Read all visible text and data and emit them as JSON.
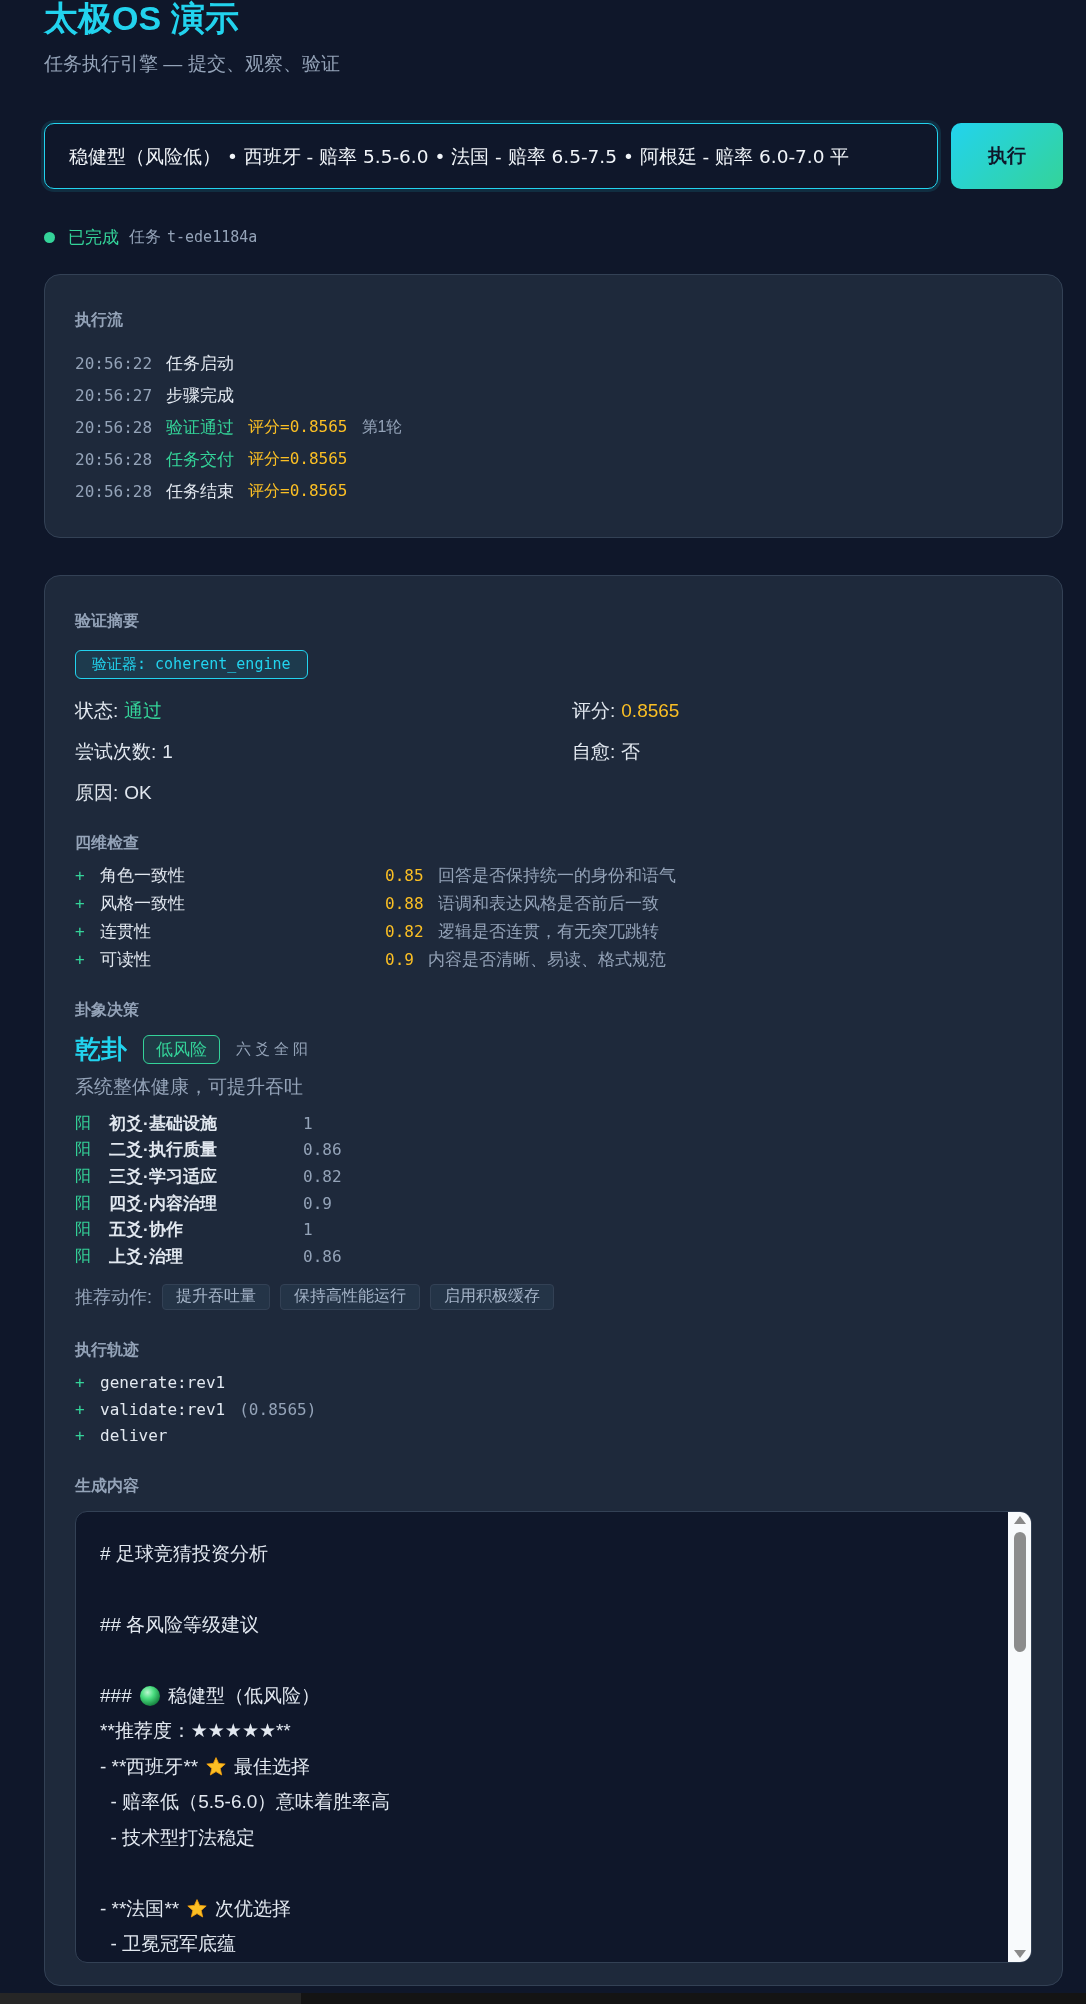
{
  "header": {
    "title": "太极OS 演示",
    "subtitle": "任务执行引擎 — 提交、观察、验证"
  },
  "task_input": {
    "value": "稳健型（风险低） • 西班牙 - 赔率 5.5-6.0 • 法国 - 赔率 6.5-7.5 • 阿根廷 - 赔率 6.0-7.0 平"
  },
  "run_button": {
    "label": "执行"
  },
  "status": {
    "done": true,
    "label": "已完成",
    "task_prefix": "任务",
    "task_id": "t-ede1184a"
  },
  "flow": {
    "title": "执行流",
    "events": [
      {
        "time": "20:56:22",
        "label": "任务启动",
        "kind": "info"
      },
      {
        "time": "20:56:27",
        "label": "步骤完成",
        "kind": "info"
      },
      {
        "time": "20:56:28",
        "label": "验证通过",
        "kind": "success",
        "score": "评分=0.8565",
        "note": "第1轮"
      },
      {
        "time": "20:56:28",
        "label": "任务交付",
        "kind": "success",
        "score": "评分=0.8565"
      },
      {
        "time": "20:56:28",
        "label": "任务结束",
        "kind": "info",
        "score": "评分=0.8565"
      }
    ]
  },
  "verification": {
    "title": "验证摘要",
    "validator": "验证器: coherent_engine",
    "fields": [
      {
        "label": "状态:",
        "value": "通过",
        "kind": "success"
      },
      {
        "label": "评分:",
        "value": "0.8565",
        "kind": "score"
      },
      {
        "label": "尝试次数:",
        "value": "1",
        "kind": "plain"
      },
      {
        "label": "自愈:",
        "value": "否",
        "kind": "plain"
      },
      {
        "label": "原因:",
        "value": "OK",
        "kind": "plain"
      }
    ],
    "checks": {
      "title": "四维检查",
      "items": [
        {
          "mark": "+",
          "name": "角色一致性",
          "score": "0.85",
          "description": "回答是否保持统一的身份和语气"
        },
        {
          "mark": "+",
          "name": "风格一致性",
          "score": "0.88",
          "description": "语调和表达风格是否前后一致"
        },
        {
          "mark": "+",
          "name": "连贯性",
          "score": "0.82",
          "description": "逻辑是否连贯，有无突兀跳转"
        },
        {
          "mark": "+",
          "name": "可读性",
          "score": "0.9",
          "description": "内容是否清晰、易读、格式规范"
        }
      ]
    },
    "hexagram": {
      "title": "卦象决策",
      "name": "乾卦",
      "risk": "低风险",
      "note": "六爻全阳",
      "summary": "系统整体健康，可提升吞吐",
      "lines": [
        {
          "sign": "阳",
          "name": "初爻·基础设施",
          "value": "1"
        },
        {
          "sign": "阳",
          "name": "二爻·执行质量",
          "value": "0.86"
        },
        {
          "sign": "阳",
          "name": "三爻·学习适应",
          "value": "0.82"
        },
        {
          "sign": "阳",
          "name": "四爻·内容治理",
          "value": "0.9"
        },
        {
          "sign": "阳",
          "name": "五爻·协作",
          "value": "1"
        },
        {
          "sign": "阳",
          "name": "上爻·治理",
          "value": "0.86"
        }
      ],
      "actions_label": "推荐动作:",
      "actions": [
        "提升吞吐量",
        "保持高性能运行",
        "启用积极缓存"
      ]
    },
    "trace": {
      "title": "执行轨迹",
      "steps": [
        {
          "mark": "+",
          "step": "generate:rev1"
        },
        {
          "mark": "+",
          "step": "validate:rev1",
          "score": "(0.8565)"
        },
        {
          "mark": "+",
          "step": "deliver"
        }
      ]
    },
    "content": {
      "title": "生成内容",
      "lines": [
        {
          "kind": "line",
          "parts": [
            {
              "kind": "text",
              "text": "# 足球竞猜投资分析"
            }
          ]
        },
        {
          "kind": "blank"
        },
        {
          "kind": "line",
          "parts": [
            {
              "kind": "text",
              "text": "## 各风险等级建议"
            }
          ]
        },
        {
          "kind": "blank"
        },
        {
          "kind": "line",
          "parts": [
            {
              "kind": "text",
              "text": "###"
            },
            {
              "kind": "dot"
            },
            {
              "kind": "text",
              "text": "稳健型（低风险）"
            }
          ]
        },
        {
          "kind": "line",
          "parts": [
            {
              "kind": "text",
              "text": "**推荐度：★★★★★**"
            }
          ]
        },
        {
          "kind": "line",
          "parts": [
            {
              "kind": "text",
              "text": "- **西班牙**"
            },
            {
              "kind": "star"
            },
            {
              "kind": "text",
              "text": "最佳选择"
            }
          ]
        },
        {
          "kind": "line",
          "parts": [
            {
              "kind": "text",
              "text": "  - 赔率低（5.5-6.0）意味着胜率高"
            }
          ]
        },
        {
          "kind": "line",
          "parts": [
            {
              "kind": "text",
              "text": "  - 技术型打法稳定"
            }
          ]
        },
        {
          "kind": "blank"
        },
        {
          "kind": "line",
          "parts": [
            {
              "kind": "text",
              "text": "- **法国**"
            },
            {
              "kind": "star"
            },
            {
              "kind": "text",
              "text": "次优选择"
            }
          ]
        },
        {
          "kind": "line",
          "parts": [
            {
              "kind": "text",
              "text": "  - 卫冕冠军底蕴"
            }
          ]
        }
      ]
    }
  }
}
